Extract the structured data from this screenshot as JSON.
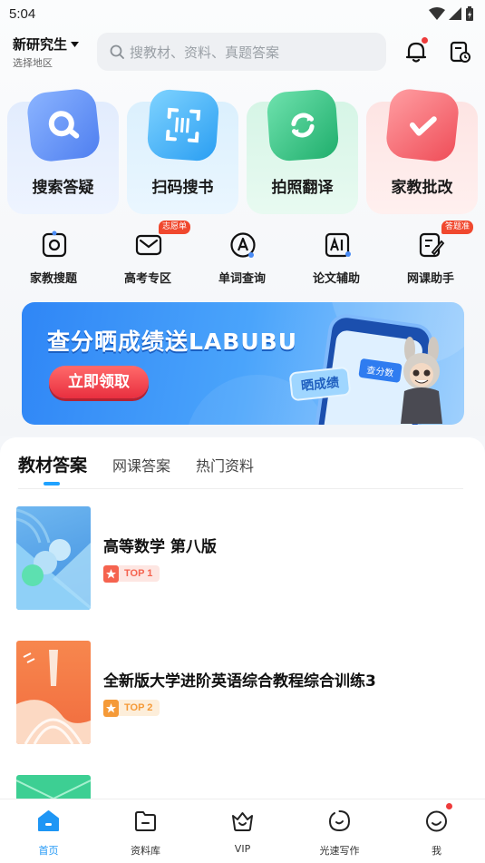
{
  "status_bar": {
    "time": "5:04"
  },
  "header": {
    "region_name": "新研究生",
    "region_sub": "选择地区",
    "search_placeholder": "搜教材、资料、真题答案"
  },
  "tiles": [
    {
      "label": "搜索答疑",
      "icon": "search-icon",
      "color": "#5b8ff5"
    },
    {
      "label": "扫码搜书",
      "icon": "scan-icon",
      "color": "#39aef3"
    },
    {
      "label": "拍照翻译",
      "icon": "translate-icon",
      "color": "#2fc388"
    },
    {
      "label": "家教批改",
      "icon": "check-icon",
      "color": "#f26d73"
    }
  ],
  "quick_links": [
    {
      "label": "家教搜题",
      "icon": "camera-search-icon",
      "badge": ""
    },
    {
      "label": "高考专区",
      "icon": "mail-icon",
      "badge": "志愿单"
    },
    {
      "label": "单词查询",
      "icon": "letter-a-icon",
      "badge": ""
    },
    {
      "label": "论文辅助",
      "icon": "ai-icon",
      "badge": ""
    },
    {
      "label": "网课助手",
      "icon": "edit-note-icon",
      "badge": "答题准"
    }
  ],
  "banner": {
    "title": "查分晒成绩送LABUBU",
    "button": "立即领取",
    "phone_tag": "查分数",
    "share_tag": "晒成绩"
  },
  "content_tabs": [
    "教材答案",
    "网课答案",
    "热门资料"
  ],
  "active_tab": 0,
  "books": [
    {
      "title": "高等数学 第八版",
      "rank": "TOP 1",
      "rank_color": "#f5634f"
    },
    {
      "title": "全新版大学进阶英语综合教程综合训练3",
      "rank": "TOP 2",
      "rank_color": "#f59a38"
    }
  ],
  "bottom_nav": [
    {
      "label": "首页",
      "icon": "home-icon",
      "active": true
    },
    {
      "label": "资料库",
      "icon": "folder-icon",
      "active": false
    },
    {
      "label": "VIP",
      "icon": "crown-icon",
      "active": false
    },
    {
      "label": "光速写作",
      "icon": "write-icon",
      "active": false
    },
    {
      "label": "我",
      "icon": "profile-icon",
      "active": false
    }
  ],
  "colors": {
    "accent": "#1e96f5",
    "badge_red": "#f0482e"
  }
}
